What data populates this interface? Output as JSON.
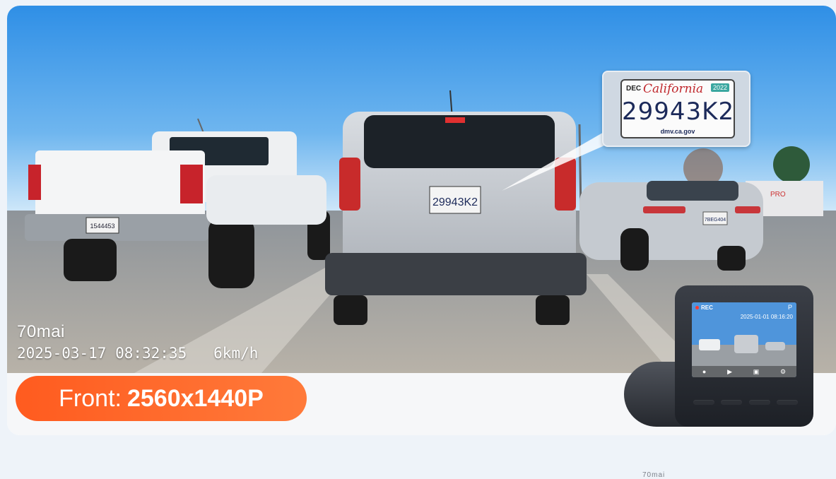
{
  "overlay": {
    "brand": "70mai",
    "timestamp": "2025-03-17 08:32:35",
    "speed": "6km/h"
  },
  "resolution_badge": {
    "label": "Front:",
    "value": "2560x1440P",
    "color": "#ff6a2a"
  },
  "plate_zoom": {
    "month": "DEC",
    "state": "California",
    "year": "2022",
    "number": "29943K2",
    "site": "dmv.ca.gov"
  },
  "scene_plates": {
    "pickup": "1544453",
    "suv": "29943K2",
    "sedan": "7BEG404"
  },
  "device": {
    "brand": "70mai",
    "screen_rec": "REC",
    "screen_top_icon": "P",
    "screen_timestamp": "2025-01-01 08:16:20",
    "icons": [
      "mic-icon",
      "play-icon",
      "gallery-icon",
      "settings-icon"
    ]
  }
}
